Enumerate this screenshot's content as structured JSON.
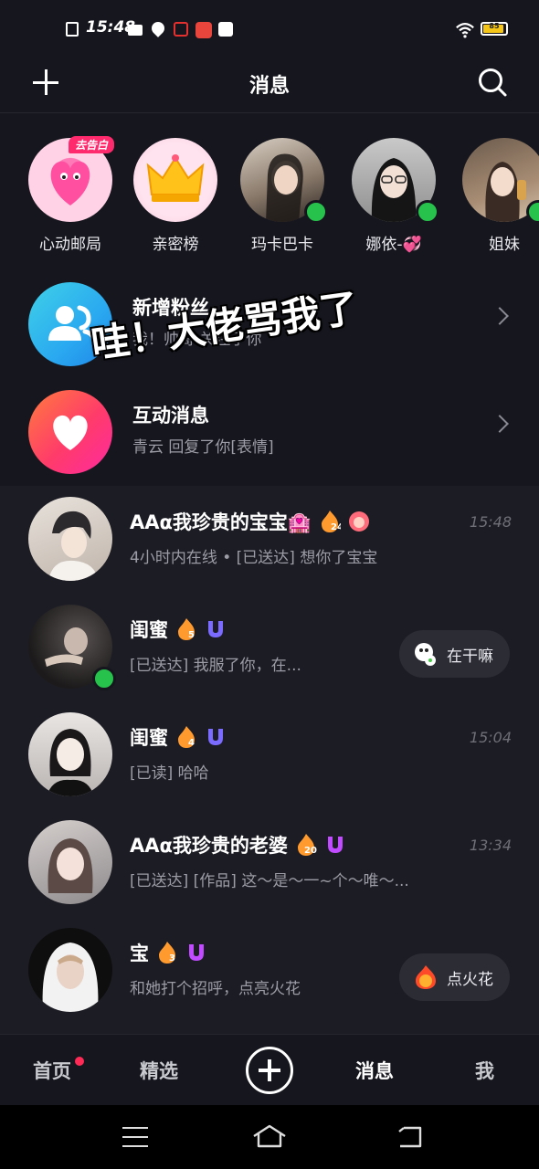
{
  "status": {
    "time": "15:48",
    "battery": "85"
  },
  "header": {
    "title": "消息"
  },
  "stories": [
    {
      "name": "心动邮局",
      "badge": "去告白"
    },
    {
      "name": "亲密榜"
    },
    {
      "name": "玛卡巴卡",
      "online": true
    },
    {
      "name": "娜依-💞",
      "online": true
    },
    {
      "name": "姐妹",
      "online": true
    }
  ],
  "features": {
    "fans": {
      "title": "新增粉丝",
      "subtitle": "我！帅哥 关注了你"
    },
    "interact": {
      "title": "互动消息",
      "subtitle": "青云 回复了你[表情]"
    }
  },
  "overlay": {
    "text": "哇！大佬骂我了"
  },
  "chats": [
    {
      "name": "AAα我珍贵的宝宝🏩",
      "streak": "24",
      "message": "4小时内在线 • [已送达] 想你了宝宝",
      "time": "15:48"
    },
    {
      "name": "闺蜜",
      "streak": "5",
      "message": "[已送达] 我服了你，在...",
      "action": "在干嘛",
      "online": true
    },
    {
      "name": "闺蜜",
      "streak": "4",
      "message": "[已读] 哈哈",
      "time": "15:04"
    },
    {
      "name": "AAα我珍贵的老婆",
      "streak": "20",
      "message": "[已送达] [作品] 这～是～一~个～唯～...",
      "time": "13:34"
    },
    {
      "name": "宝",
      "streak": "3",
      "message": "和她打个招呼，点亮火花",
      "action": "点火花"
    }
  ],
  "nav": {
    "home": "首页",
    "featured": "精选",
    "messages": "消息",
    "me": "我"
  },
  "colors": {
    "bg": "#16161e",
    "list_bg": "#1c1c24",
    "online": "#27c24c",
    "accent": "#ff2a55"
  }
}
